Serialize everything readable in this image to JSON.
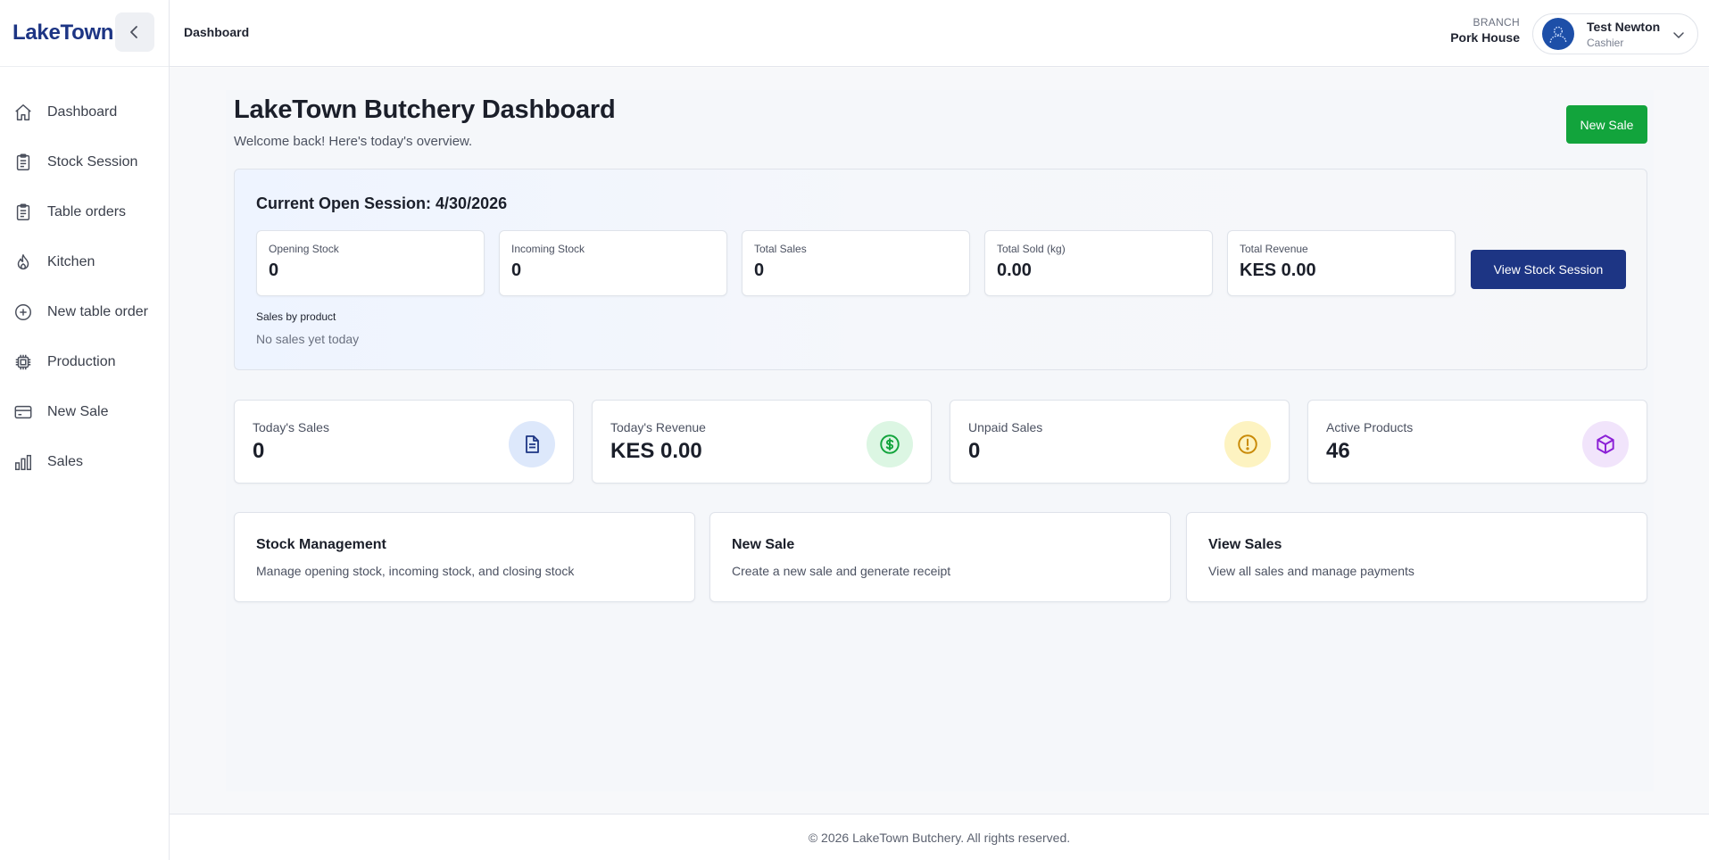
{
  "sidebar": {
    "brand": "LakeTown",
    "items": [
      {
        "label": "Dashboard",
        "icon": "home-icon"
      },
      {
        "label": "Stock Session",
        "icon": "clipboard-icon"
      },
      {
        "label": "Table orders",
        "icon": "clipboard-icon"
      },
      {
        "label": "Kitchen",
        "icon": "flame-icon"
      },
      {
        "label": "New table order",
        "icon": "plus-circle-icon"
      },
      {
        "label": "Production",
        "icon": "chip-icon"
      },
      {
        "label": "New Sale",
        "icon": "credit-card-icon"
      },
      {
        "label": "Sales",
        "icon": "bar-chart-icon"
      }
    ]
  },
  "header": {
    "breadcrumb": "Dashboard",
    "branch_caption": "BRANCH",
    "branch_name": "Pork House",
    "user_name": "Test Newton",
    "user_role": "Cashier"
  },
  "page": {
    "title": "LakeTown Butchery Dashboard",
    "subtitle": "Welcome back! Here's today's overview.",
    "new_sale_label": "New Sale"
  },
  "session": {
    "title": "Current Open Session: 4/30/2026",
    "stats": [
      {
        "label": "Opening Stock",
        "value": "0"
      },
      {
        "label": "Incoming Stock",
        "value": "0"
      },
      {
        "label": "Total Sales",
        "value": "0"
      },
      {
        "label": "Total Sold (kg)",
        "value": "0.00"
      },
      {
        "label": "Total Revenue",
        "value": "KES 0.00"
      }
    ],
    "view_button": "View Stock Session",
    "sales_by_product_label": "Sales by product",
    "sales_by_product_empty": "No sales yet today"
  },
  "kpis": [
    {
      "label": "Today's Sales",
      "value": "0",
      "icon": "document-icon",
      "color": "#1d3584",
      "bg": "#dde8fb"
    },
    {
      "label": "Today's Revenue",
      "value": "KES 0.00",
      "icon": "dollar-icon",
      "color": "#12a43c",
      "bg": "#dcf6e3"
    },
    {
      "label": "Unpaid Sales",
      "value": "0",
      "icon": "alert-icon",
      "color": "#c98a06",
      "bg": "#fdf3c1"
    },
    {
      "label": "Active Products",
      "value": "46",
      "icon": "box-icon",
      "color": "#8b1fd6",
      "bg": "#f1e4fb"
    }
  ],
  "actions": [
    {
      "title": "Stock Management",
      "description": "Manage opening stock, incoming stock, and closing stock"
    },
    {
      "title": "New Sale",
      "description": "Create a new sale and generate receipt"
    },
    {
      "title": "View Sales",
      "description": "View all sales and manage payments"
    }
  ],
  "footer": "© 2026 LakeTown Butchery. All rights reserved."
}
